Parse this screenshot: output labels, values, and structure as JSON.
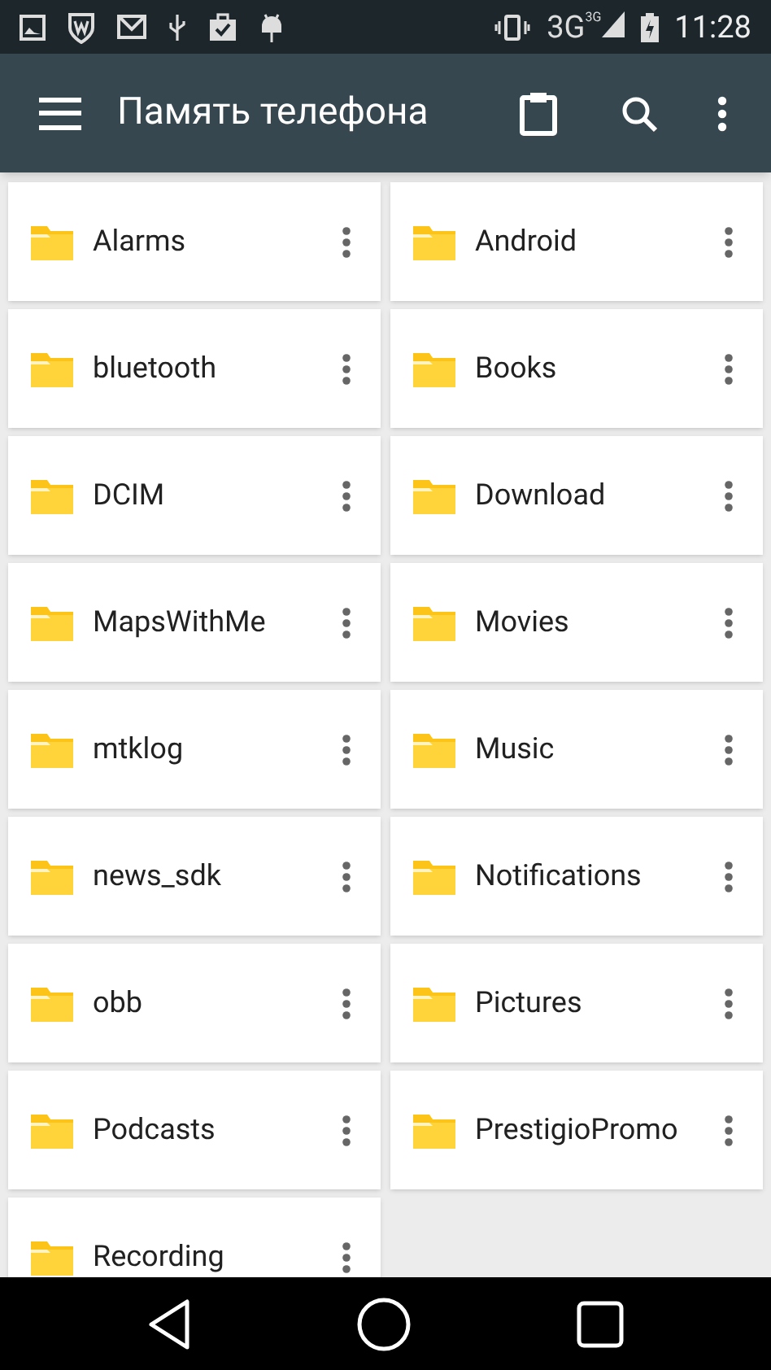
{
  "status_bar": {
    "network": "3G",
    "network_badge": "3G",
    "time": "11:28"
  },
  "toolbar": {
    "title": "Память телефона"
  },
  "folders": [
    {
      "name": "Alarms"
    },
    {
      "name": "Android"
    },
    {
      "name": "bluetooth"
    },
    {
      "name": "Books"
    },
    {
      "name": "DCIM"
    },
    {
      "name": "Download"
    },
    {
      "name": "MapsWithMe"
    },
    {
      "name": "Movies"
    },
    {
      "name": "mtklog"
    },
    {
      "name": "Music"
    },
    {
      "name": "news_sdk"
    },
    {
      "name": "Notifications"
    },
    {
      "name": "obb"
    },
    {
      "name": "Pictures"
    },
    {
      "name": "Podcasts"
    },
    {
      "name": "PrestigioPromo"
    },
    {
      "name": "Recording"
    }
  ]
}
